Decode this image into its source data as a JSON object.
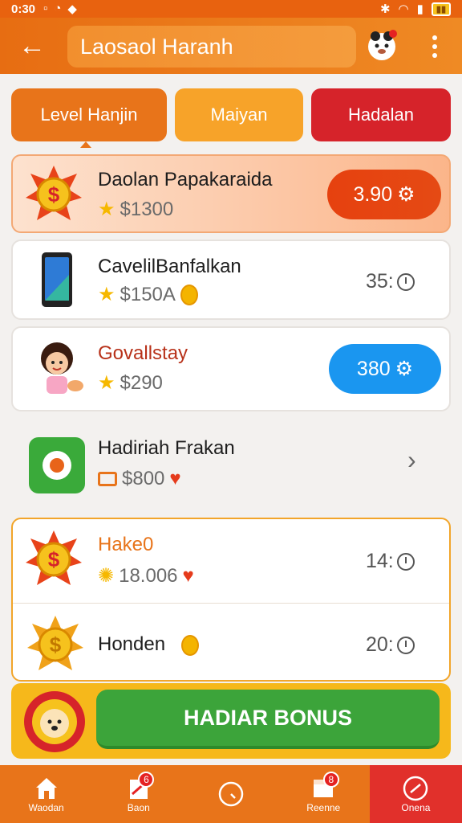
{
  "status_bar": {
    "time": "0:30"
  },
  "app_bar": {
    "title": "Laosaol Haranh"
  },
  "tabs": [
    {
      "label": "Level Hanjin"
    },
    {
      "label": "Maiyan"
    },
    {
      "label": "Hadalan"
    }
  ],
  "rows": [
    {
      "title": "Daolan Papakaraida",
      "price": "$1300",
      "action": "3.90"
    },
    {
      "title": "CavelilBanfalkan",
      "price": "$150A",
      "timer": "35:"
    },
    {
      "title": "Govallstay",
      "price": "$290",
      "action": "380"
    },
    {
      "title": "Hadiriah Frakan",
      "price": "$800"
    },
    {
      "title": "Hake0",
      "price": "18.006",
      "timer": "14:"
    },
    {
      "title": "Honden",
      "timer": "20:"
    }
  ],
  "bonus": {
    "button_label": "HADIAR BONUS"
  },
  "bottom_nav": [
    {
      "label": "Waodan"
    },
    {
      "label": "Baon",
      "badge": "6"
    },
    {
      "label": ""
    },
    {
      "label": "Reenne",
      "badge": "8"
    },
    {
      "label": "Onena"
    }
  ],
  "colors": {
    "primary": "#e8741a",
    "accent_red": "#d6232a",
    "accent_blue": "#1a96f0",
    "bonus_green": "#3ca43a"
  }
}
